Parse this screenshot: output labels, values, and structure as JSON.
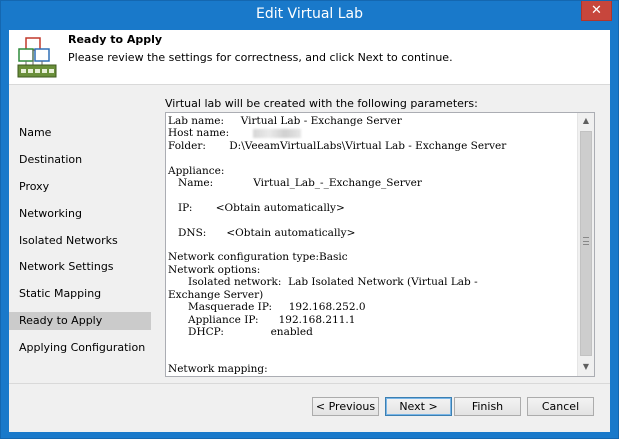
{
  "window": {
    "title": "Edit Virtual Lab",
    "close_glyph": "✕"
  },
  "header": {
    "title": "Ready to Apply",
    "description": "Please review the settings for correctness, and click Next to continue.",
    "icon": "virtual-lab-icon"
  },
  "nav": {
    "items": [
      {
        "label": "Name",
        "active": false
      },
      {
        "label": "Destination",
        "active": false
      },
      {
        "label": "Proxy",
        "active": false
      },
      {
        "label": "Networking",
        "active": false
      },
      {
        "label": "Isolated Networks",
        "active": false
      },
      {
        "label": "Network Settings",
        "active": false
      },
      {
        "label": "Static Mapping",
        "active": false
      },
      {
        "label": "Ready to Apply",
        "active": true
      },
      {
        "label": "Applying Configuration",
        "active": false
      }
    ]
  },
  "params": {
    "label": "Virtual lab will be created with the following parameters:",
    "lines": [
      "Lab name:     Virtual Lab - Exchange Server",
      "Host name:",
      "Folder:       D:\\VeeamVirtualLabs\\Virtual Lab - Exchange Server",
      "",
      "Appliance:",
      "   Name:            Virtual_Lab_-_Exchange_Server",
      "",
      "   IP:       <Obtain automatically>",
      "",
      "   DNS:      <Obtain automatically>",
      "",
      "Network configuration type:Basic",
      "Network options:",
      "      Isolated network:  Lab Isolated Network (Virtual Lab -",
      "Exchange Server)",
      "      Masquerade IP:     192.168.252.0",
      "      Appliance IP:      192.168.211.1",
      "      DHCP:              enabled",
      "",
      "",
      "Network mapping:"
    ]
  },
  "buttons": {
    "previous": "< Previous",
    "next": "Next >",
    "finish": "Finish",
    "cancel": "Cancel"
  },
  "scrollbar": {
    "up_glyph": "▲",
    "down_glyph": "▼"
  }
}
